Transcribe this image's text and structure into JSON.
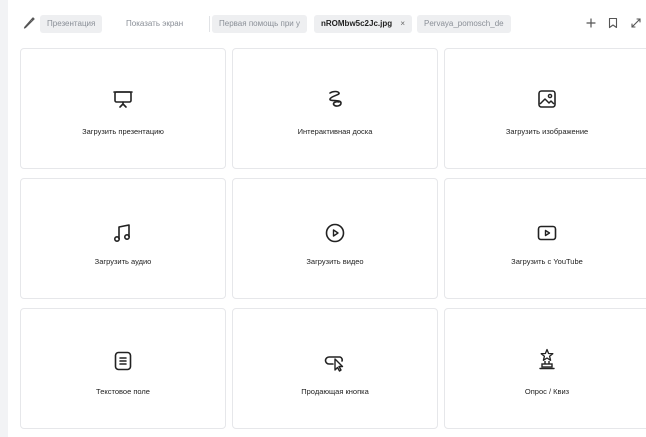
{
  "toolbar": {
    "tabs": [
      {
        "label": "Презентация"
      },
      {
        "label": "Показать экран"
      },
      {
        "label": "Первая помощь при у"
      },
      {
        "label": "nROMbw5c2Jc.jpg",
        "close": "×"
      },
      {
        "label": "Pervaya_pomosch_de"
      }
    ],
    "icons": [
      "pencil-icon",
      "plus-icon",
      "bookmark-icon",
      "expand-icon"
    ]
  },
  "cards": [
    {
      "label": "Загрузить презентацию",
      "icon": "presentation-icon"
    },
    {
      "label": "Интерактивная доска",
      "icon": "whiteboard-icon"
    },
    {
      "label": "Загрузить изображение",
      "icon": "image-icon"
    },
    {
      "label": "Загрузить аудио",
      "icon": "music-icon"
    },
    {
      "label": "Загрузить видео",
      "icon": "play-circle-icon"
    },
    {
      "label": "Загрузить с YouTube",
      "icon": "youtube-icon"
    },
    {
      "label": "Текстовое поле",
      "icon": "text-field-icon"
    },
    {
      "label": "Продающая кнопка",
      "icon": "cursor-button-icon"
    },
    {
      "label": "Опрос / Квиз",
      "icon": "trophy-icon"
    }
  ]
}
